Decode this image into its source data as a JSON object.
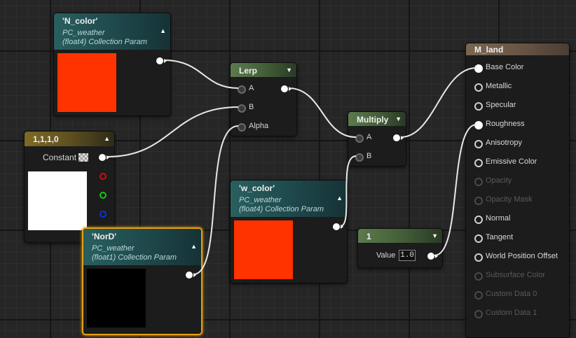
{
  "nodes": {
    "n_color": {
      "title": "'N_color'",
      "collection": "PC_weather",
      "type": "(float4) Collection Param",
      "swatch_color": "#ff3300"
    },
    "lerp": {
      "title": "Lerp",
      "inputs": [
        "A",
        "B",
        "Alpha"
      ]
    },
    "multiply": {
      "title": "Multiply",
      "inputs": [
        "A",
        "B"
      ]
    },
    "constant": {
      "title": "1,1,1,0",
      "label": "Constant",
      "swatch_color": "#ffffff"
    },
    "w_color": {
      "title": "'w_color'",
      "collection": "PC_weather",
      "type": "(float4) Collection Param",
      "swatch_color": "#ff3300"
    },
    "nord": {
      "title": "'NorD'",
      "collection": "PC_weather",
      "type": "(float1) Collection Param",
      "swatch_color": "#000000"
    },
    "scalar": {
      "title": "1",
      "label": "Value",
      "value": "1.0"
    },
    "m_land": {
      "title": "M_land",
      "inputs": [
        "Base Color",
        "Metallic",
        "Specular",
        "Roughness",
        "Anisotropy",
        "Emissive Color",
        "Opacity",
        "Opacity Mask",
        "Normal",
        "Tangent",
        "World Position Offset",
        "Subsurface Color",
        "Custom Data 0",
        "Custom Data 1"
      ]
    }
  }
}
